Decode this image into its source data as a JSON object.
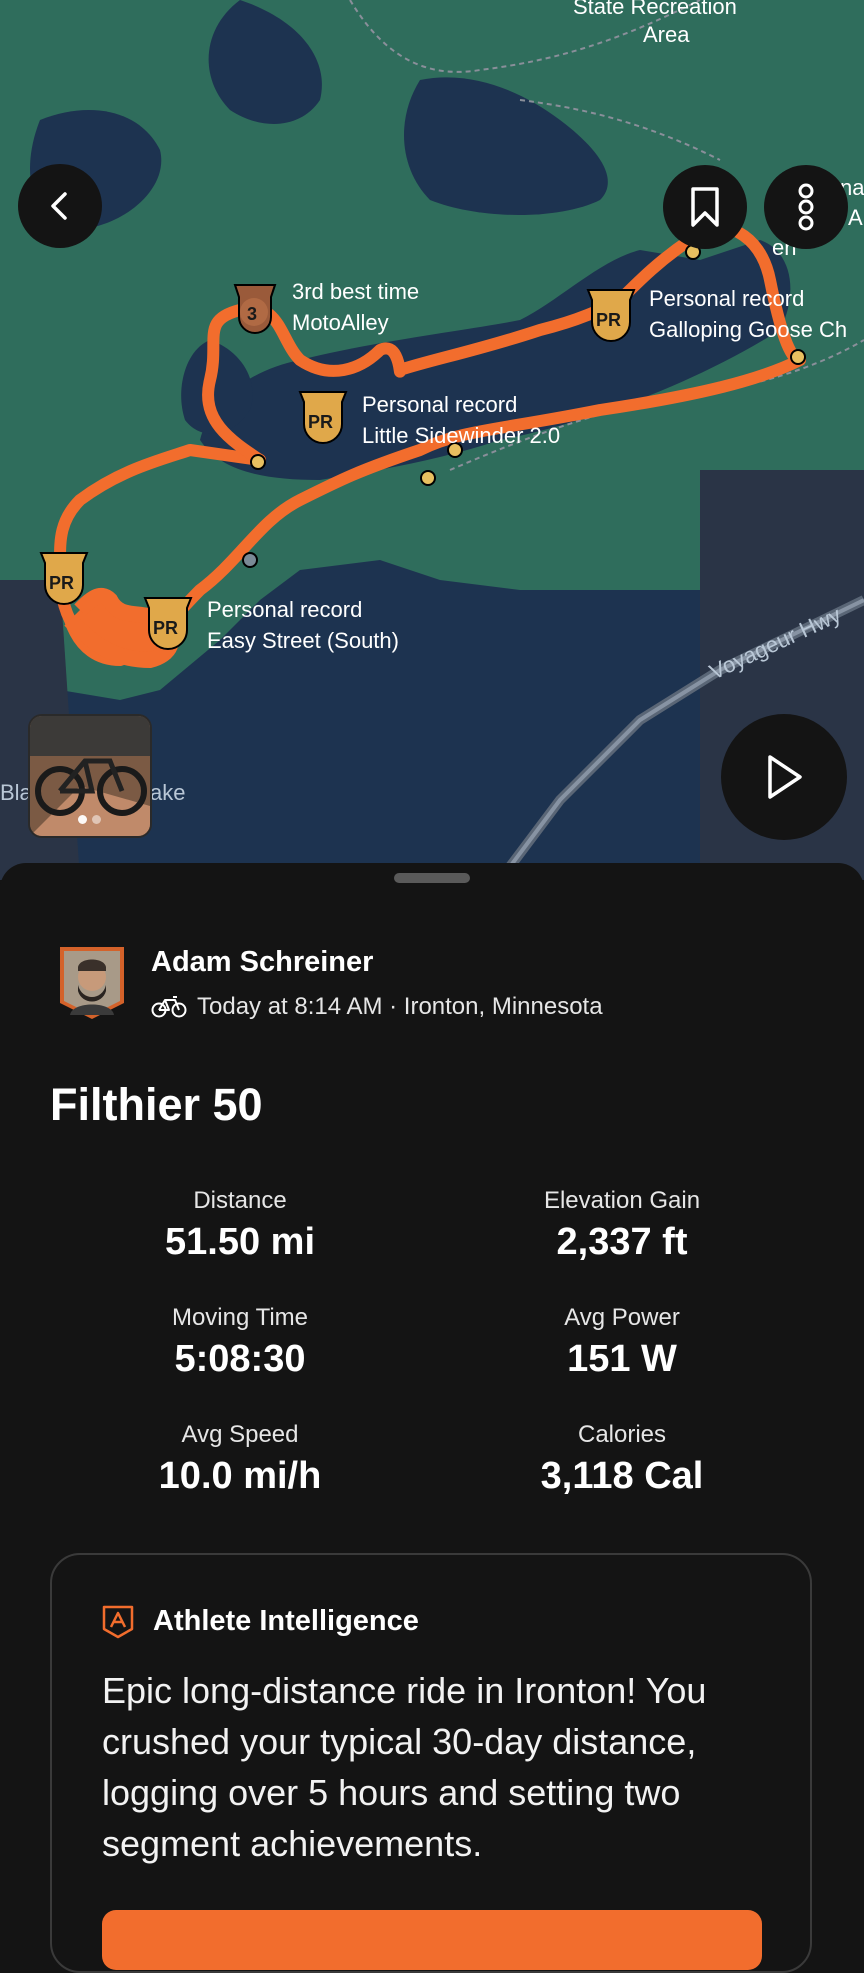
{
  "map": {
    "area_label_line1": "State Recreation",
    "area_label_line2": "Area",
    "road_label": "Voyageur Hwy",
    "lake_label_left": "Bla",
    "lake_label_right": "ake",
    "edge_label_1": "na",
    "edge_label_2": "A",
    "edge_label_3": "en",
    "achievements": [
      {
        "badge": "3",
        "line1": "3rd best time",
        "line2": "MotoAlley"
      },
      {
        "badge": "PR",
        "line1": "Personal record",
        "line2": "Galloping Goose Ch"
      },
      {
        "badge": "PR",
        "line1": "Personal record",
        "line2": "Little Sidewinder 2.0"
      },
      {
        "badge": "PR",
        "line1": "Personal record",
        "line2": "Easy Street (South)"
      },
      {
        "badge": "PR",
        "line1": "",
        "line2": ""
      }
    ],
    "colors": {
      "water": "#1d3350",
      "land": "#2f6d5c",
      "route": "#f26d2d",
      "badge": "#e0a84a"
    }
  },
  "athlete": {
    "name": "Adam Schreiner",
    "meta": "Today at 8:14 AM · Ironton, Minnesota",
    "activity_icon": "bike-icon"
  },
  "activity": {
    "title": "Filthier 50",
    "stats": [
      {
        "label": "Distance",
        "value": "51.50 mi"
      },
      {
        "label": "Elevation Gain",
        "value": "2,337 ft"
      },
      {
        "label": "Moving Time",
        "value": "5:08:30"
      },
      {
        "label": "Avg Power",
        "value": "151 W"
      },
      {
        "label": "Avg Speed",
        "value": "10.0 mi/h"
      },
      {
        "label": "Calories",
        "value": "3,118 Cal"
      }
    ]
  },
  "intelligence": {
    "title": "Athlete Intelligence",
    "body": "Epic long-distance ride in Ironton! You crushed your typical 30-day distance, logging over 5 hours and setting two segment achievements."
  },
  "photos": {
    "count": 2,
    "current": 1
  }
}
